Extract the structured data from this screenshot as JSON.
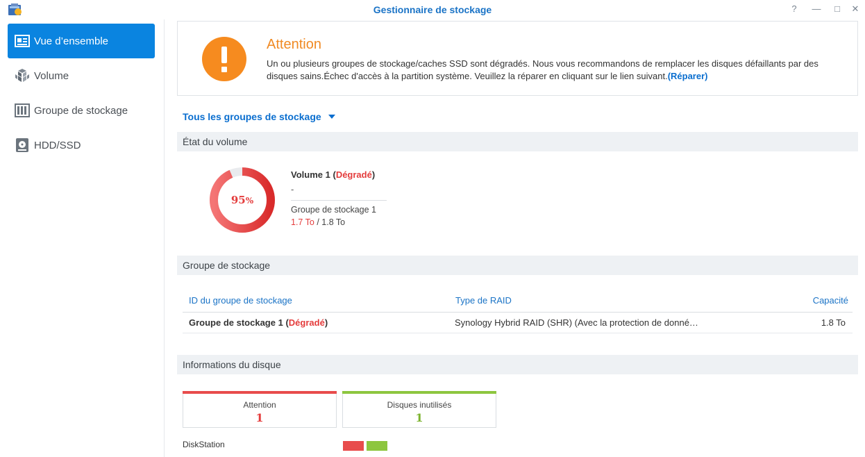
{
  "window": {
    "title": "Gestionnaire de stockage",
    "help_glyph": "?",
    "minimize_glyph": "—",
    "maximize_glyph": "□",
    "close_glyph": "✕"
  },
  "sidebar": {
    "items": [
      {
        "label": "Vue d’ensemble",
        "icon": "overview-icon",
        "active": true
      },
      {
        "label": "Volume",
        "icon": "cubes-icon",
        "active": false
      },
      {
        "label": "Groupe de stockage",
        "icon": "storage-pool-icon",
        "active": false
      },
      {
        "label": "HDD/SSD",
        "icon": "disk-icon",
        "active": false
      }
    ]
  },
  "alert": {
    "title": "Attention",
    "text": "Un ou plusieurs groupes de stockage/caches SSD sont dégradés. Nous vous recommandons de remplacer les disques défaillants par des disques sains.Échec d'accès à la partition système. Veuillez la réparer en cliquant sur le lien suivant.",
    "link": "(Réparer)",
    "accent": "#f68b1f"
  },
  "pool_selector": {
    "label": "Tous les groupes de stockage"
  },
  "volume_state": {
    "header": "État du volume",
    "usage_percent": 95,
    "usage_label": "95",
    "percent_sign": "%",
    "volume_name": "Volume 1",
    "status_open": "(",
    "status": "Dégradé",
    "status_close": ")",
    "description": "-",
    "pool_name": "Groupe de stockage 1",
    "used": "1.7 To",
    "separator": "/",
    "total": "1.8 To",
    "ring_color": "#e43c3c",
    "ring_track": "#e9ebee"
  },
  "storage_pool": {
    "header": "Groupe de stockage",
    "columns": {
      "id": "ID du groupe de stockage",
      "raid": "Type de RAID",
      "capacity": "Capacité"
    },
    "rows": [
      {
        "name": "Groupe de stockage 1",
        "status": "Dégradé",
        "raid": "Synology Hybrid RAID (SHR) (Avec la protection de donné…",
        "capacity": "1.8 To"
      }
    ]
  },
  "disk_info": {
    "header": "Informations du disque",
    "cards": [
      {
        "label": "Attention",
        "count": "1",
        "color": "#e84c4c"
      },
      {
        "label": "Disques inutilisés",
        "count": "1",
        "color": "#8dc63f"
      }
    ],
    "device": "DiskStation",
    "slots": [
      {
        "status": "attention",
        "color": "#e84c4c"
      },
      {
        "status": "unused",
        "color": "#8dc63f"
      }
    ]
  }
}
